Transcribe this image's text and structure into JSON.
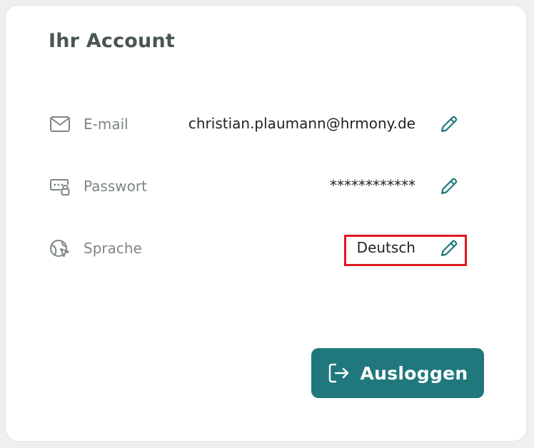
{
  "account": {
    "title": "Ihr Account",
    "rows": [
      {
        "label": "E-mail",
        "value": "christian.plaumann@hrmony.de",
        "icon": "mail-icon"
      },
      {
        "label": "Passwort",
        "value": "************",
        "icon": "password-lock-icon"
      },
      {
        "label": "Sprache",
        "value": "Deutsch",
        "icon": "language-globe-icon"
      }
    ],
    "logout_label": "Ausloggen"
  },
  "colors": {
    "accent": "#20787d",
    "highlight_border": "#e0191f"
  }
}
